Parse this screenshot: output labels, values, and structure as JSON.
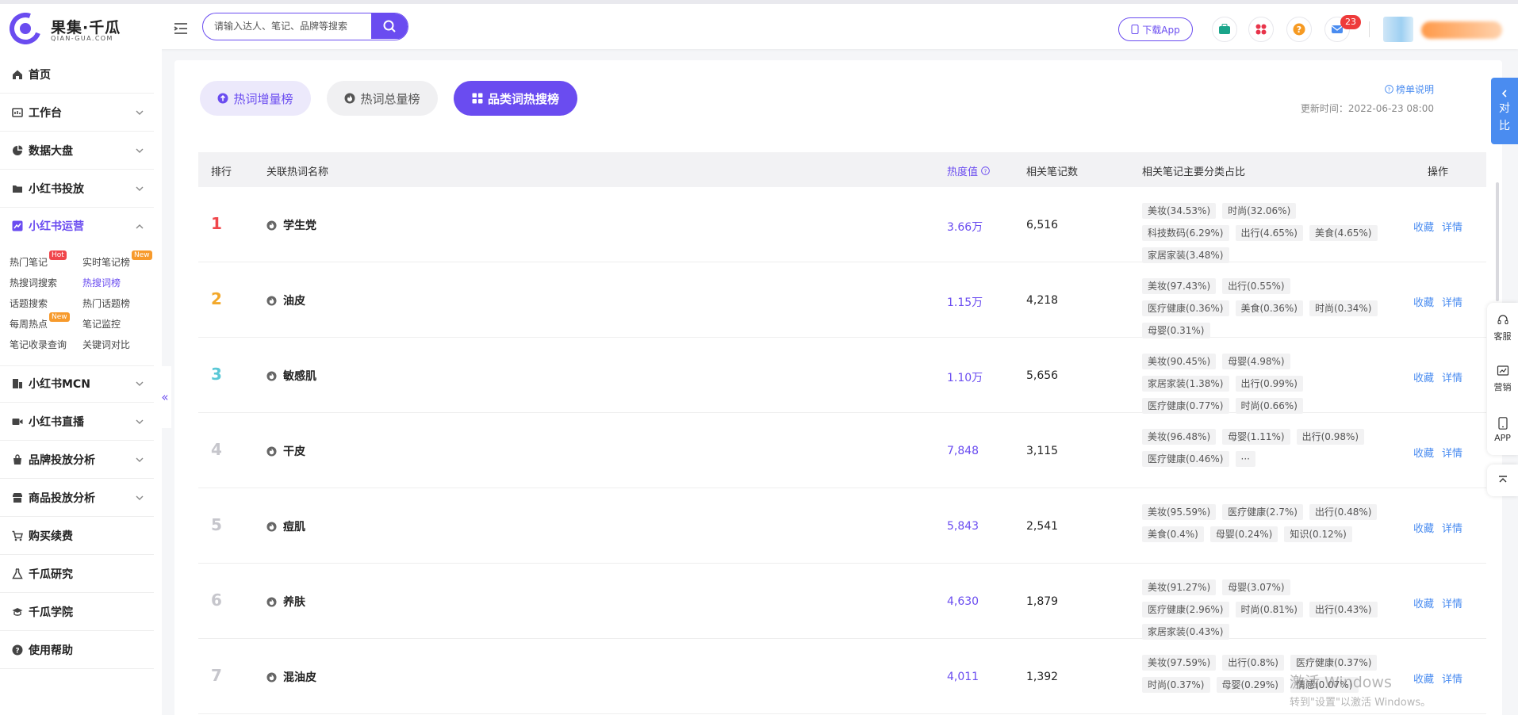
{
  "header": {
    "logo_cn": "果集·千瓜",
    "logo_en": "QIAN-GUA.COM",
    "search_placeholder": "请输入达人、笔记、品牌等搜索",
    "download_app": "下载App",
    "message_count": "23",
    "accent": "#6a4cf0"
  },
  "sidebar": {
    "items": [
      {
        "label": "首页",
        "icon": "home-icon"
      },
      {
        "label": "工作台",
        "icon": "workbench-icon"
      },
      {
        "label": "数据大盘",
        "icon": "pie-icon"
      },
      {
        "label": "小红书投放",
        "icon": "folder-icon"
      },
      {
        "label": "小红书运营",
        "icon": "trend-icon"
      },
      {
        "label": "小红书MCN",
        "icon": "building-icon"
      },
      {
        "label": "小红书直播",
        "icon": "video-icon"
      },
      {
        "label": "品牌投放分析",
        "icon": "bag-icon"
      },
      {
        "label": "商品投放分析",
        "icon": "shop-icon"
      },
      {
        "label": "购买续费",
        "icon": "cart-icon"
      },
      {
        "label": "千瓜研究",
        "icon": "flask-icon"
      },
      {
        "label": "千瓜学院",
        "icon": "graduation-icon"
      },
      {
        "label": "使用帮助",
        "icon": "help-icon"
      }
    ],
    "sub": [
      {
        "label": "热门笔记",
        "tag": "Hot"
      },
      {
        "label": "实时笔记榜",
        "tag": "New"
      },
      {
        "label": "热搜词搜索"
      },
      {
        "label": "热搜词榜"
      },
      {
        "label": "话题搜索"
      },
      {
        "label": "热门话题榜"
      },
      {
        "label": "每周热点",
        "tag": "New"
      },
      {
        "label": "笔记监控"
      },
      {
        "label": "笔记收录查询"
      },
      {
        "label": "关键词对比"
      }
    ],
    "collapse": "«"
  },
  "tabs": {
    "rise": "热词增量榜",
    "total": "热词总量榜",
    "category": "品类词热搜榜"
  },
  "explain": "榜单说明",
  "updated_label": "更新时间：",
  "updated_value": "2022-06-23 08:00",
  "table": {
    "headers": {
      "rank": "排行",
      "keyword": "关联热词名称",
      "heat": "热度值",
      "notes": "相关笔记数",
      "cats": "相关笔记主要分类占比",
      "ops": "操作"
    },
    "rows": [
      {
        "rank": "1",
        "keyword": "学生党",
        "heat": "3.66万",
        "notes": "6,516",
        "cats": [
          "美妆(34.53%)",
          "时尚(32.06%)",
          "科技数码(6.29%)",
          "出行(4.65%)",
          "美食(4.65%)",
          "家居家装(3.48%)"
        ]
      },
      {
        "rank": "2",
        "keyword": "油皮",
        "heat": "1.15万",
        "notes": "4,218",
        "cats": [
          "美妆(97.43%)",
          "出行(0.55%)",
          "医疗健康(0.36%)",
          "美食(0.36%)",
          "时尚(0.34%)",
          "母婴(0.31%)"
        ]
      },
      {
        "rank": "3",
        "keyword": "敏感肌",
        "heat": "1.10万",
        "notes": "5,656",
        "cats": [
          "美妆(90.45%)",
          "母婴(4.98%)",
          "家居家装(1.38%)",
          "出行(0.99%)",
          "医疗健康(0.77%)",
          "时尚(0.66%)"
        ]
      },
      {
        "rank": "4",
        "keyword": "干皮",
        "heat": "7,848",
        "notes": "3,115",
        "cats": [
          "美妆(96.48%)",
          "母婴(1.11%)",
          "出行(0.98%)",
          "医疗健康(0.46%)",
          "···"
        ]
      },
      {
        "rank": "5",
        "keyword": "痘肌",
        "heat": "5,843",
        "notes": "2,541",
        "cats": [
          "美妆(95.59%)",
          "医疗健康(2.7%)",
          "出行(0.48%)",
          "美食(0.4%)",
          "母婴(0.24%)",
          "知识(0.12%)"
        ]
      },
      {
        "rank": "6",
        "keyword": "养肤",
        "heat": "4,630",
        "notes": "1,879",
        "cats": [
          "美妆(91.27%)",
          "母婴(3.07%)",
          "医疗健康(2.96%)",
          "时尚(0.81%)",
          "出行(0.43%)",
          "家居家装(0.43%)"
        ]
      },
      {
        "rank": "7",
        "keyword": "混油皮",
        "heat": "4,011",
        "notes": "1,392",
        "cats": [
          "美妆(97.59%)",
          "出行(0.8%)",
          "医疗健康(0.37%)",
          "时尚(0.37%)",
          "母婴(0.29%)",
          "情感(0.07%)"
        ]
      }
    ],
    "op_collect": "收藏",
    "op_detail": "详情"
  },
  "right": {
    "compare": [
      "对",
      "比"
    ],
    "service": "客服",
    "marketing": "营销",
    "app": "APP"
  },
  "watermark": {
    "title": "激活 Windows",
    "sub": "转到\"设置\"以激活 Windows。"
  }
}
